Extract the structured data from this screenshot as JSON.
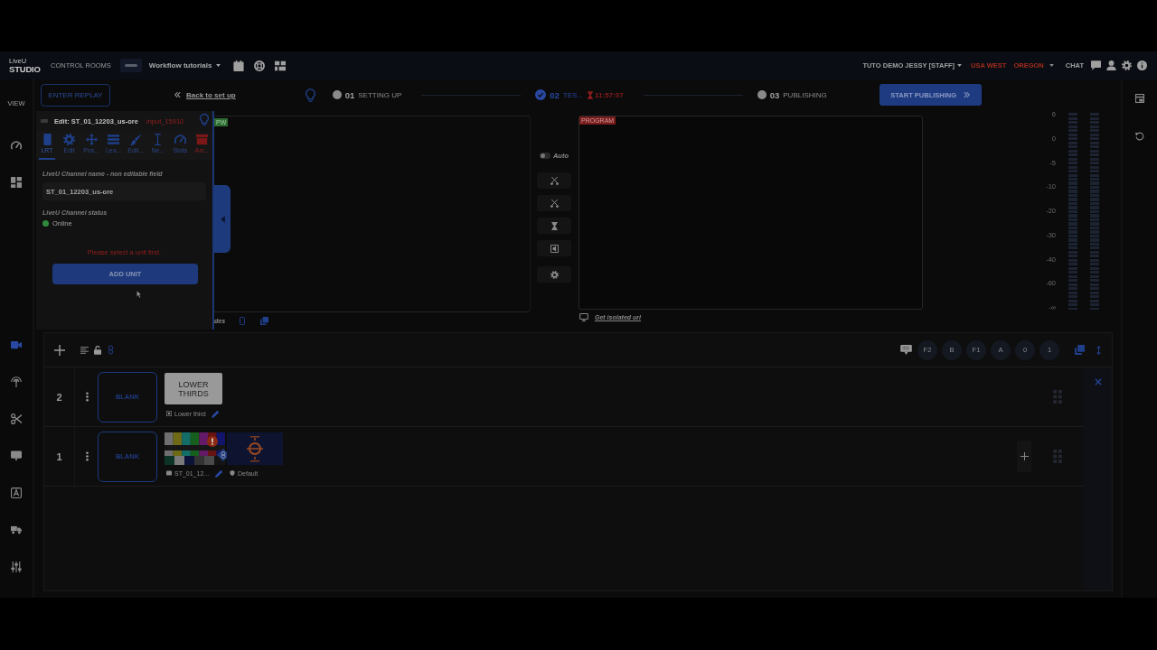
{
  "top_bar": {
    "logo_small": "LiveU",
    "logo_large": "STUDIO",
    "nav_link": "CONTROL ROOMS",
    "workspace": "Workflow tutorials",
    "user": "TUTO DEMO JESSY [STAFF]",
    "region": "USA WEST",
    "location": "OREGON",
    "chat": "CHAT"
  },
  "left_sidebar": {
    "label": "VIEW",
    "upper_items": [
      {
        "kind": "gauge",
        "selected": false
      },
      {
        "kind": "dashboard",
        "selected": false
      }
    ],
    "lower_items": [
      {
        "kind": "camera",
        "selected": true
      },
      {
        "kind": "antenna",
        "selected": false
      },
      {
        "kind": "scissors",
        "selected": false
      },
      {
        "kind": "presentation",
        "selected": false
      },
      {
        "kind": "text",
        "selected": false
      },
      {
        "kind": "truck",
        "selected": false
      },
      {
        "kind": "sliders",
        "selected": false
      }
    ]
  },
  "steps_bar": {
    "replay_button": "ENTER REPLAY",
    "back_link": "Back to set up",
    "steps": [
      {
        "number": "01",
        "label": "SETTING UP",
        "done": false
      },
      {
        "number": "02",
        "label": "TES...",
        "done": true,
        "timer": "11:57:07"
      },
      {
        "number": "03",
        "label": "PUBLISHING",
        "done": false
      }
    ],
    "publish_button": "START PUBLISHING"
  },
  "edit_panel": {
    "title": "Edit: ST_01_12203_us-ore",
    "input_id": "input_15910",
    "tabs": [
      {
        "kind": "lrt",
        "label": "LRT",
        "selected": true
      },
      {
        "kind": "edit",
        "label": "Edit",
        "selected": false
      },
      {
        "kind": "position",
        "label": "Pos...",
        "selected": false
      },
      {
        "kind": "layers",
        "label": "Lea...",
        "selected": false
      },
      {
        "kind": "style",
        "label": "Edit...",
        "selected": false
      },
      {
        "kind": "name",
        "label": "Ne...",
        "selected": false
      },
      {
        "kind": "stats",
        "label": "Stats",
        "selected": false
      },
      {
        "kind": "archive",
        "label": "Arc...",
        "selected": false
      }
    ],
    "name_label": "LiveU Channel name - non editable field",
    "name_value": "ST_01_12203_us-ore",
    "status_label": "LiveU Channel status",
    "status": {
      "text": "Online",
      "color": "#2f8a3c"
    },
    "warning": "Please select a unit first.",
    "add_button": "ADD UNIT"
  },
  "preview": {
    "badge": "PW",
    "footer_label": "des"
  },
  "transition": {
    "auto": {
      "label": "Auto",
      "on": false
    },
    "buttons": [
      {
        "kind": "crossed"
      },
      {
        "kind": "crossed"
      },
      {
        "kind": "hourglass"
      },
      {
        "kind": "door"
      },
      {
        "kind": "settings"
      }
    ]
  },
  "program": {
    "badge": "PROGRAM",
    "link": "Get isolated url"
  },
  "audio_meter": {
    "scale": [
      "6",
      "0",
      "-5",
      "-10",
      "-20",
      "-30",
      "-40",
      "-60",
      "-∞"
    ]
  },
  "layers": {
    "shortcuts": [
      "F2",
      "B",
      "F1",
      "A",
      "0",
      "1"
    ],
    "rows": [
      {
        "number": "2",
        "blank": "BLANK",
        "add_button": false,
        "sources": [
          {
            "kind": "lower_third",
            "thumb_text": "LOWER THIRDS",
            "name": "Lower third",
            "editable": true,
            "warning": false,
            "linked": false
          }
        ]
      },
      {
        "number": "1",
        "blank": "BLANK",
        "add_button": true,
        "sources": [
          {
            "kind": "input",
            "name": "ST_01_12…",
            "editable": true,
            "warning": true,
            "linked": true
          },
          {
            "kind": "graphic",
            "name": "Default",
            "editable": false,
            "warning": false,
            "linked": false
          }
        ]
      }
    ]
  }
}
